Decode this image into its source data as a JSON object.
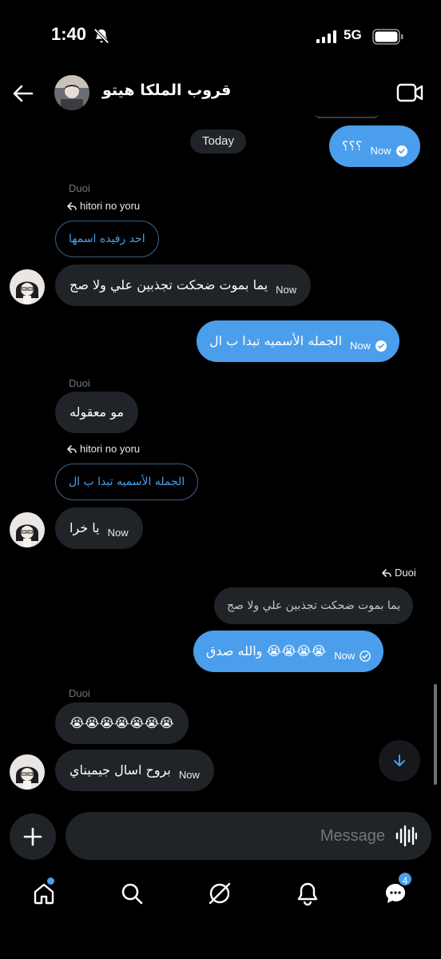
{
  "status": {
    "time": "1:40",
    "network": "5G"
  },
  "header": {
    "title": "قروب الملكا هيتو"
  },
  "chat": {
    "day_label": "Today",
    "msg1": {
      "text": "؟؟؟",
      "time": "Now"
    },
    "reply1": {
      "sender": "Duoi",
      "reply_to": "hitori no yoru",
      "quoted": "احد رفيده اسمها"
    },
    "msg2": {
      "text": "يما بموت ضحكت تجذبين علي ولا صج",
      "time": "Now"
    },
    "msg3": {
      "text": "الجمله الأسميه تبدا ب ال",
      "time": "Now"
    },
    "msg4": {
      "sender": "Duoi",
      "text": "مو معقوله"
    },
    "reply2": {
      "reply_to": "hitori no yoru",
      "quoted": "الجمله الأسميه تبدا ب ال"
    },
    "msg5": {
      "text": "يا خرا",
      "time": "Now"
    },
    "reply3": {
      "reply_to": "Duoi",
      "quoted": "يما بموت ضحكت تجذبين علي ولا صج"
    },
    "msg6": {
      "text": "والله صدق 😭😭😭😭",
      "time": "Now"
    },
    "msg7": {
      "sender": "Duoi",
      "text": "😭😭😭😭😭😭😭"
    },
    "msg8": {
      "text": "بروح اسال جيميناي",
      "time": "Now"
    }
  },
  "composer": {
    "placeholder": "Message"
  },
  "nav": {
    "messages_badge": "4"
  },
  "colors": {
    "accent": "#4a9eeb",
    "bubble_in": "#202327",
    "background": "#000000"
  }
}
